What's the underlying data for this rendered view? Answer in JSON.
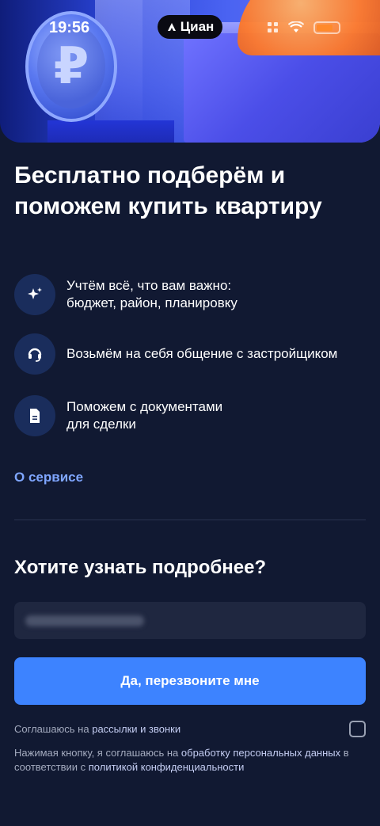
{
  "status_bar": {
    "time": "19:56",
    "brand": "Циан",
    "accent_color": "#ff8a2a"
  },
  "hero": {
    "coin_symbol": "₽"
  },
  "title": "Бесплатно подберём и поможем купить квартиру",
  "features": [
    {
      "icon": "sparkle-icon",
      "text": "Учтём всё, что вам важно:\nбюджет, район, планировку"
    },
    {
      "icon": "headset-icon",
      "text": "Возьмём на себя общение с застройщиком"
    },
    {
      "icon": "document-icon",
      "text": "Поможем с документами\nдля сделки"
    }
  ],
  "about_link": "О сервисе",
  "subtitle": "Хотите узнать подробнее?",
  "phone_input": {
    "value": ""
  },
  "cta_label": "Да, перезвоните мне",
  "consent": {
    "prefix": "Соглашаюсь на ",
    "link": "рассылки и звонки",
    "checked": false
  },
  "legal": {
    "part1": "Нажимая кнопку, я соглашаюсь на ",
    "link1": "обработку персональных данных",
    "part2": " в соответствии с ",
    "link2": "политикой конфиденциальности"
  },
  "colors": {
    "background": "#111932",
    "primary_button": "#3d83ff",
    "link": "#7fa6ff",
    "icon_bg": "#1a2d5c"
  }
}
